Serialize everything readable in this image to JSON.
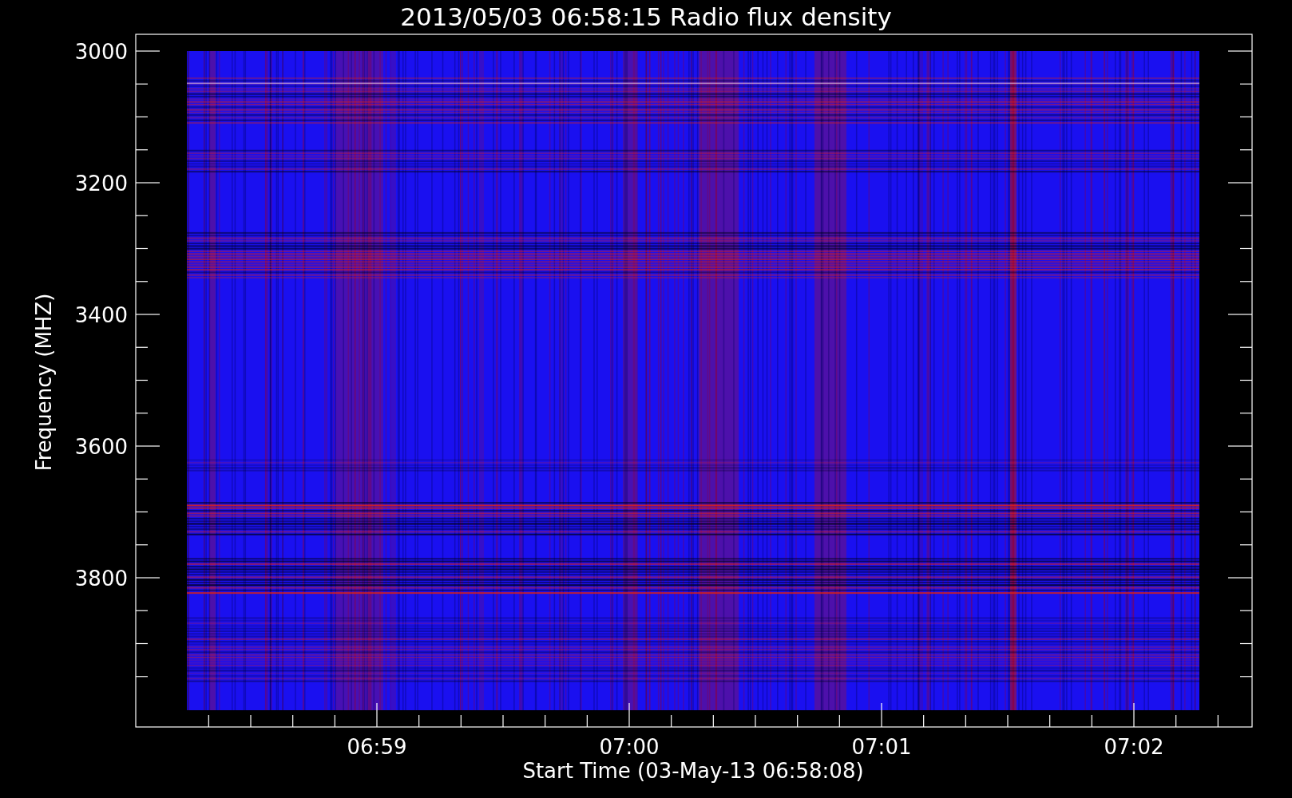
{
  "title": "2013/05/03 06:58:15 Radio flux density",
  "y_axis": {
    "label": "Frequency (MHZ)",
    "ticks": [
      "3000",
      "3200",
      "3400",
      "3600",
      "3800"
    ]
  },
  "x_axis": {
    "label": "Start Time (03-May-13 06:58:08)",
    "ticks": [
      "06:59",
      "07:00",
      "07:01",
      "07:02"
    ]
  }
}
